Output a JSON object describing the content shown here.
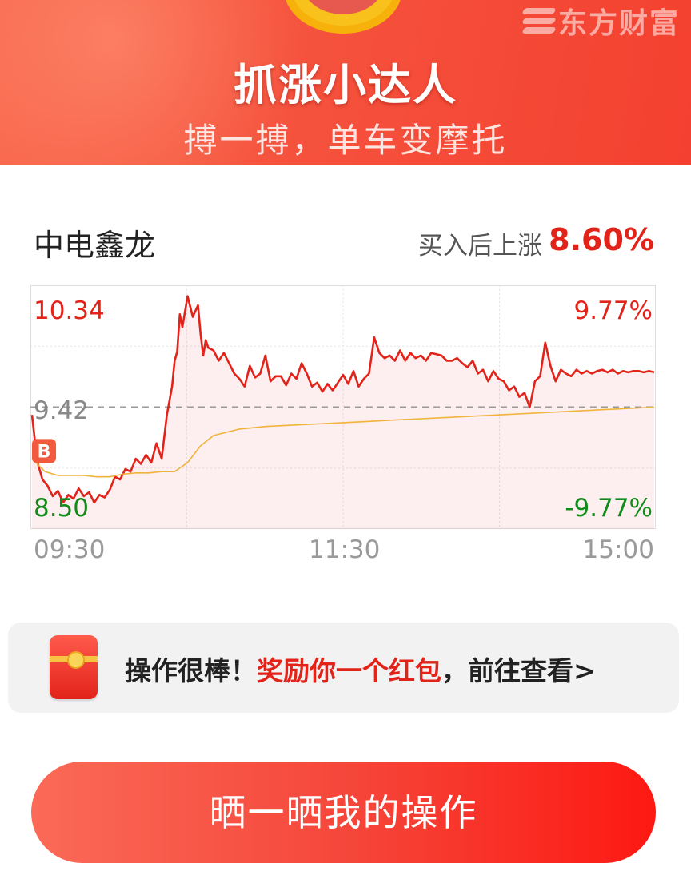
{
  "header": {
    "brand": "东方财富",
    "title": "抓涨小达人",
    "subtitle": "搏一搏，单车变摩托"
  },
  "stock": {
    "name": "中电鑫龙",
    "gain_label": "买入后上涨",
    "gain_value": "8.60%"
  },
  "chart_data": {
    "type": "line",
    "title": "",
    "xlabel": "",
    "ylabel": "",
    "x_ticks": [
      "09:30",
      "11:30",
      "15:00"
    ],
    "y_left_labels": {
      "top": "10.34",
      "middle": "9.42",
      "bottom": "8.50"
    },
    "y_right_labels": {
      "top": "9.77%",
      "bottom": "-9.77%"
    },
    "ylim": [
      8.5,
      10.34
    ],
    "prev_close": 9.42,
    "buy_marker": {
      "label": "B",
      "time_index": 0,
      "price": 9.08
    },
    "time_range": [
      0,
      240
    ],
    "series": [
      {
        "color": "#e2231a",
        "x": [
          0,
          2,
          4,
          6,
          8,
          10,
          12,
          14,
          16,
          18,
          20,
          22,
          24,
          26,
          28,
          30,
          32,
          34,
          36,
          38,
          40,
          42,
          44,
          46,
          48,
          50,
          52,
          54,
          55,
          56,
          57,
          58,
          60,
          62,
          64,
          65,
          66,
          67,
          68,
          70,
          72,
          74,
          76,
          78,
          80,
          82,
          84,
          86,
          88,
          90,
          92,
          94,
          96,
          98,
          100,
          102,
          104,
          106,
          108,
          110,
          112,
          114,
          116,
          118,
          120,
          122,
          124,
          126,
          128,
          130,
          132,
          134,
          136,
          138,
          140,
          142,
          144,
          146,
          148,
          150,
          152,
          154,
          156,
          158,
          160,
          162,
          164,
          166,
          168,
          170,
          172,
          174,
          176,
          178,
          180,
          182,
          184,
          186,
          188,
          190,
          192,
          194,
          196,
          198,
          200,
          202,
          204,
          206,
          208,
          210,
          212,
          214,
          216,
          218,
          220,
          222,
          224,
          226,
          228,
          230,
          232,
          234,
          236,
          238,
          240
        ],
        "values": [
          9.36,
          9.0,
          8.86,
          8.81,
          8.73,
          8.77,
          8.68,
          8.74,
          8.71,
          8.79,
          8.73,
          8.76,
          8.68,
          8.74,
          8.72,
          8.78,
          8.88,
          8.86,
          8.94,
          8.92,
          9.02,
          8.98,
          9.05,
          8.99,
          9.14,
          9.02,
          9.36,
          9.58,
          9.78,
          9.85,
          10.14,
          10.04,
          10.28,
          10.12,
          10.21,
          9.99,
          9.82,
          9.94,
          9.88,
          9.86,
          9.78,
          9.84,
          9.76,
          9.68,
          9.64,
          9.58,
          9.74,
          9.65,
          9.68,
          9.82,
          9.62,
          9.66,
          9.66,
          9.59,
          9.68,
          9.64,
          9.76,
          9.68,
          9.58,
          9.61,
          9.54,
          9.6,
          9.55,
          9.61,
          9.67,
          9.6,
          9.7,
          9.58,
          9.64,
          9.68,
          9.96,
          9.84,
          9.8,
          9.82,
          9.78,
          9.86,
          9.78,
          9.84,
          9.8,
          9.82,
          9.78,
          9.84,
          9.83,
          9.82,
          9.78,
          9.78,
          9.8,
          9.76,
          9.73,
          9.78,
          9.68,
          9.71,
          9.62,
          9.7,
          9.64,
          9.62,
          9.55,
          9.58,
          9.5,
          9.53,
          9.42,
          9.62,
          9.66,
          9.92,
          9.74,
          9.62,
          9.71,
          9.68,
          9.66,
          9.71,
          9.68,
          9.7,
          9.68,
          9.7,
          9.71,
          9.69,
          9.71,
          9.68,
          9.7,
          9.69,
          9.7,
          9.7,
          9.69,
          9.7,
          9.69
        ]
      },
      {
        "color": "#f0b33c",
        "x": [
          0,
          5,
          10,
          15,
          20,
          25,
          30,
          35,
          40,
          45,
          50,
          55,
          60,
          65,
          70,
          80,
          90,
          100,
          110,
          120,
          130,
          140,
          150,
          160,
          170,
          180,
          190,
          200,
          210,
          220,
          230,
          240
        ],
        "values": [
          9.02,
          8.92,
          8.89,
          8.89,
          8.89,
          8.88,
          8.88,
          8.9,
          8.91,
          8.91,
          8.92,
          8.92,
          8.99,
          9.12,
          9.2,
          9.25,
          9.27,
          9.28,
          9.29,
          9.3,
          9.31,
          9.32,
          9.33,
          9.34,
          9.35,
          9.36,
          9.37,
          9.38,
          9.39,
          9.4,
          9.41,
          9.42
        ]
      }
    ],
    "colors": {
      "up": "#e2231a",
      "down": "#118c1a",
      "neutral": "#999999"
    }
  },
  "notice": {
    "prefix": "操作很棒！",
    "highlight": "奖励你一个红包",
    "suffix": "，前往查看>"
  },
  "share_button": {
    "label": "晒一晒我的操作"
  }
}
